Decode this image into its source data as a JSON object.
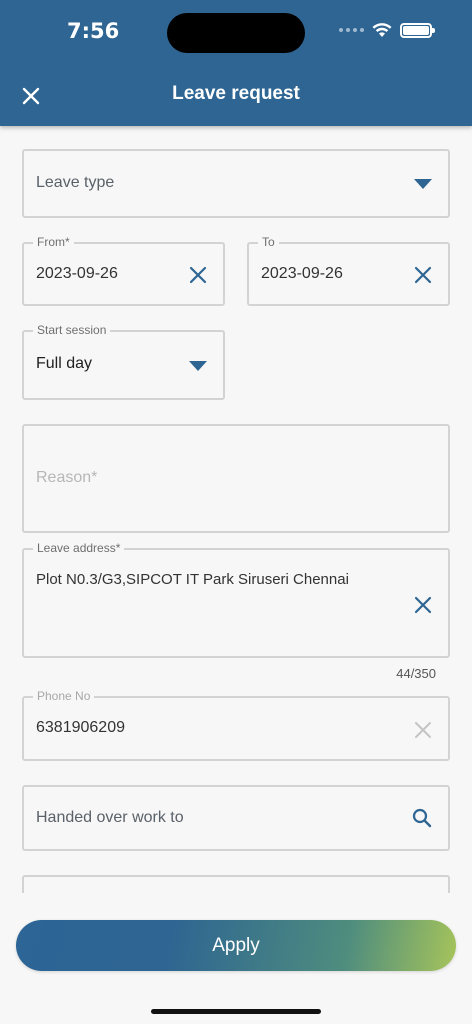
{
  "status_bar": {
    "time": "7:56"
  },
  "header": {
    "title": "Leave request"
  },
  "form": {
    "leave_type": {
      "placeholder": "Leave type"
    },
    "from": {
      "label": "From*",
      "value": "2023-09-26"
    },
    "to": {
      "label": "To",
      "value": "2023-09-26"
    },
    "start_session": {
      "label": "Start session",
      "value": "Full day"
    },
    "reason": {
      "placeholder": "Reason*"
    },
    "leave_address": {
      "label": "Leave address*",
      "value": "Plot N0.3/G3,SIPCOT IT Park Siruseri Chennai",
      "counter": "44/350"
    },
    "phone": {
      "label": "Phone No",
      "value": "6381906209"
    },
    "handed_over": {
      "placeholder": "Handed over work to"
    }
  },
  "actions": {
    "apply_label": "Apply"
  },
  "colors": {
    "header_bg": "#2e6592",
    "accent": "#2e6592",
    "border": "#d3d3d3"
  }
}
